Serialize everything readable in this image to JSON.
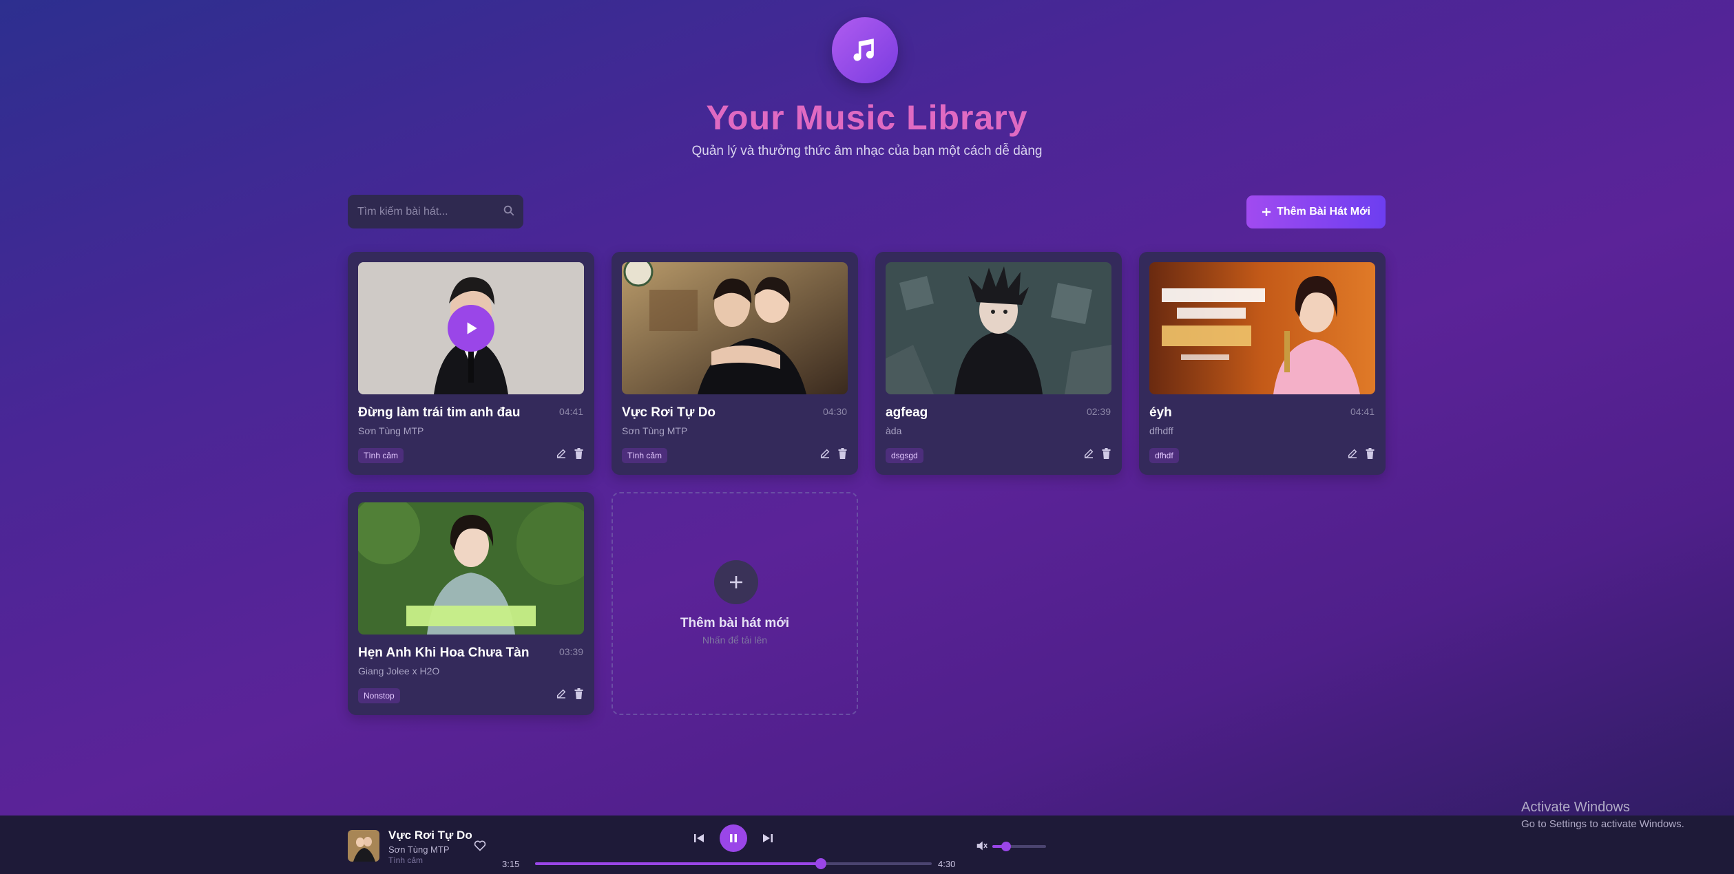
{
  "header": {
    "title": "Your Music Library",
    "subtitle": "Quản lý và thưởng thức âm nhạc của bạn một cách dễ dàng",
    "logo_icon": "music-note-icon"
  },
  "search": {
    "placeholder": "Tìm kiếm bài hát...",
    "icon": "search-icon"
  },
  "add_button": {
    "label": "Thêm Bài Hát Mới",
    "icon": "plus-icon"
  },
  "songs": [
    {
      "title": "Đừng làm trái tim anh đau",
      "artist": "Sơn Tùng MTP",
      "duration": "04:41",
      "genre": "Tình cảm",
      "playing_overlay": true
    },
    {
      "title": "Vực Rơi Tự Do",
      "artist": "Sơn Tùng MTP",
      "duration": "04:30",
      "genre": "Tình cảm"
    },
    {
      "title": "agfeag",
      "artist": "àda",
      "duration": "02:39",
      "genre": "dsgsgd"
    },
    {
      "title": "éyh",
      "artist": "dfhdff",
      "duration": "04:41",
      "genre": "dfhdf"
    },
    {
      "title": "Hẹn Anh Khi Hoa Chưa Tàn",
      "artist": "Giang Jolee x H2O",
      "duration": "03:39",
      "genre": "Nonstop"
    }
  ],
  "add_card": {
    "title": "Thêm bài hát mới",
    "subtitle": "Nhấn để tải lên"
  },
  "player": {
    "title": "Vực Rơi Tự Do",
    "artist": "Sơn Tùng MTP",
    "genre": "Tình cảm",
    "current_time": "3:15",
    "total_time": "4:30",
    "progress": 0.72,
    "volume": 0.25,
    "state": "playing"
  },
  "watermark": {
    "line1": "Activate Windows",
    "line2": "Go to Settings to activate Windows."
  },
  "colors": {
    "accent": "#9a46e8",
    "title": "#e06ac2",
    "card": "#342a5b",
    "player_bg": "#1e1a38"
  }
}
